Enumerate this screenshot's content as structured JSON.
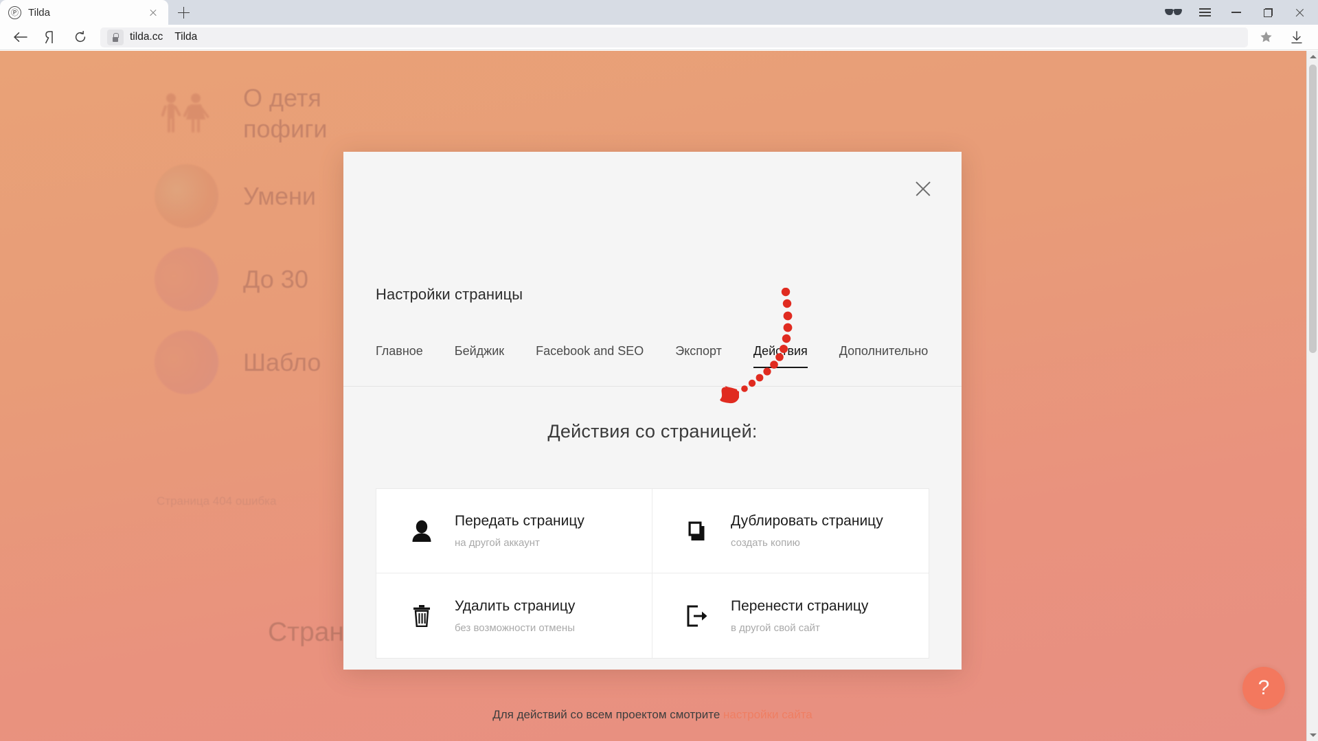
{
  "browser": {
    "tab": {
      "title": "Tilda",
      "favicon_icon": "tilda-logo-icon",
      "close_icon": "close-icon"
    },
    "new_tab_icon": "plus-icon",
    "window_controls": {
      "glasses_icon": "glasses-icon",
      "menu_icon": "hamburger-menu-icon",
      "minimize_icon": "minimize-icon",
      "maximize_icon": "maximize-icon",
      "close_icon": "close-icon"
    },
    "nav": {
      "back_icon": "back-arrow-icon",
      "yandex_icon": "yandex-logo-icon",
      "reload_icon": "reload-icon",
      "lock_icon": "lock-icon",
      "url_host": "tilda.cc",
      "url_title": "Tilda",
      "bookmark_icon": "star-icon",
      "download_icon": "download-icon"
    }
  },
  "page": {
    "list": [
      {
        "title": "О детя\nпофиги",
        "thumb": "children-holding-hands-icon"
      },
      {
        "title": "Умени",
        "thumb": "book-photo"
      },
      {
        "title": "До 30",
        "thumb": "number-3-photo"
      },
      {
        "title": "Шабло",
        "thumb": "number-3-photo"
      }
    ],
    "footnote": "Страница 404 ошибка",
    "big_title": "Страни",
    "help_button": "?"
  },
  "modal": {
    "title": "Настройки страницы",
    "close_icon": "close-icon",
    "tabs": [
      {
        "label": "Главное",
        "active": false
      },
      {
        "label": "Бейджик",
        "active": false
      },
      {
        "label": "Facebook and SEO",
        "active": false
      },
      {
        "label": "Экспорт",
        "active": false
      },
      {
        "label": "Действия",
        "active": true
      },
      {
        "label": "Дополнительно",
        "active": false
      }
    ],
    "heading": "Действия со страницей:",
    "actions": [
      {
        "label": "Передать страницу",
        "sub": "на другой аккаунт",
        "icon": "person-icon"
      },
      {
        "label": "Дублировать страницу",
        "sub": "создать копию",
        "icon": "copy-icon"
      },
      {
        "label": "Удалить страницу",
        "sub": "без возможности отмены",
        "icon": "trash-icon"
      },
      {
        "label": "Перенести страницу",
        "sub": "в другой свой сайт",
        "icon": "move-out-icon"
      }
    ],
    "footer_text": "Для действий со всем проектом смотрите",
    "footer_link": "настройки сайта"
  },
  "annotation": {
    "type": "dotted-arrow",
    "color": "#e02b20",
    "points_to": "Дублировать страницу"
  },
  "colors": {
    "accent": "#ef7e62",
    "bg_top": "#e9a277",
    "bg_bottom": "#e88f82",
    "modal_bg": "#f5f5f5",
    "annotation_red": "#e02b20"
  }
}
